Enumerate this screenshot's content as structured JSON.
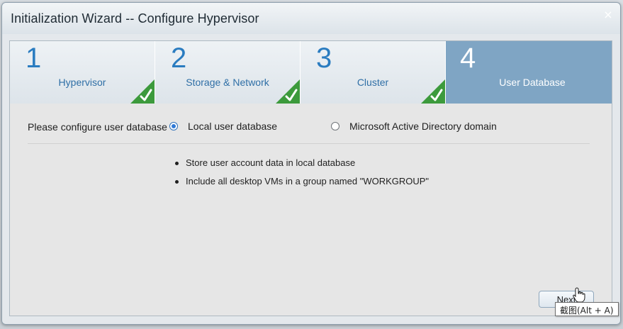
{
  "window": {
    "title": "Initialization Wizard -- Configure Hypervisor",
    "close_glyph": "×"
  },
  "steps": [
    {
      "number": "1",
      "label": "Hypervisor",
      "completed": true,
      "active": false
    },
    {
      "number": "2",
      "label": "Storage & Network",
      "completed": true,
      "active": false
    },
    {
      "number": "3",
      "label": "Cluster",
      "completed": true,
      "active": false
    },
    {
      "number": "4",
      "label": "User Database",
      "completed": false,
      "active": true
    }
  ],
  "user_db": {
    "prompt": "Please configure user database",
    "options": [
      {
        "label": "Local user database",
        "selected": true
      },
      {
        "label": "Microsoft Active Directory domain",
        "selected": false
      }
    ],
    "bullets": [
      "Store user account data in local database",
      "Include all desktop VMs in a group named \"WORKGROUP\""
    ]
  },
  "footer": {
    "next_label": "Next"
  },
  "tooltip": {
    "text": "截图(Alt + A)"
  },
  "colors": {
    "accent_active_step": "#7fa5c4",
    "step_text": "#2f6fa6",
    "check_green": "#3c9a3c",
    "radio_selected": "#2f79d6"
  },
  "icons": {
    "close": "close-icon",
    "check": "checkmark-icon",
    "cursor": "hand-cursor-icon"
  }
}
